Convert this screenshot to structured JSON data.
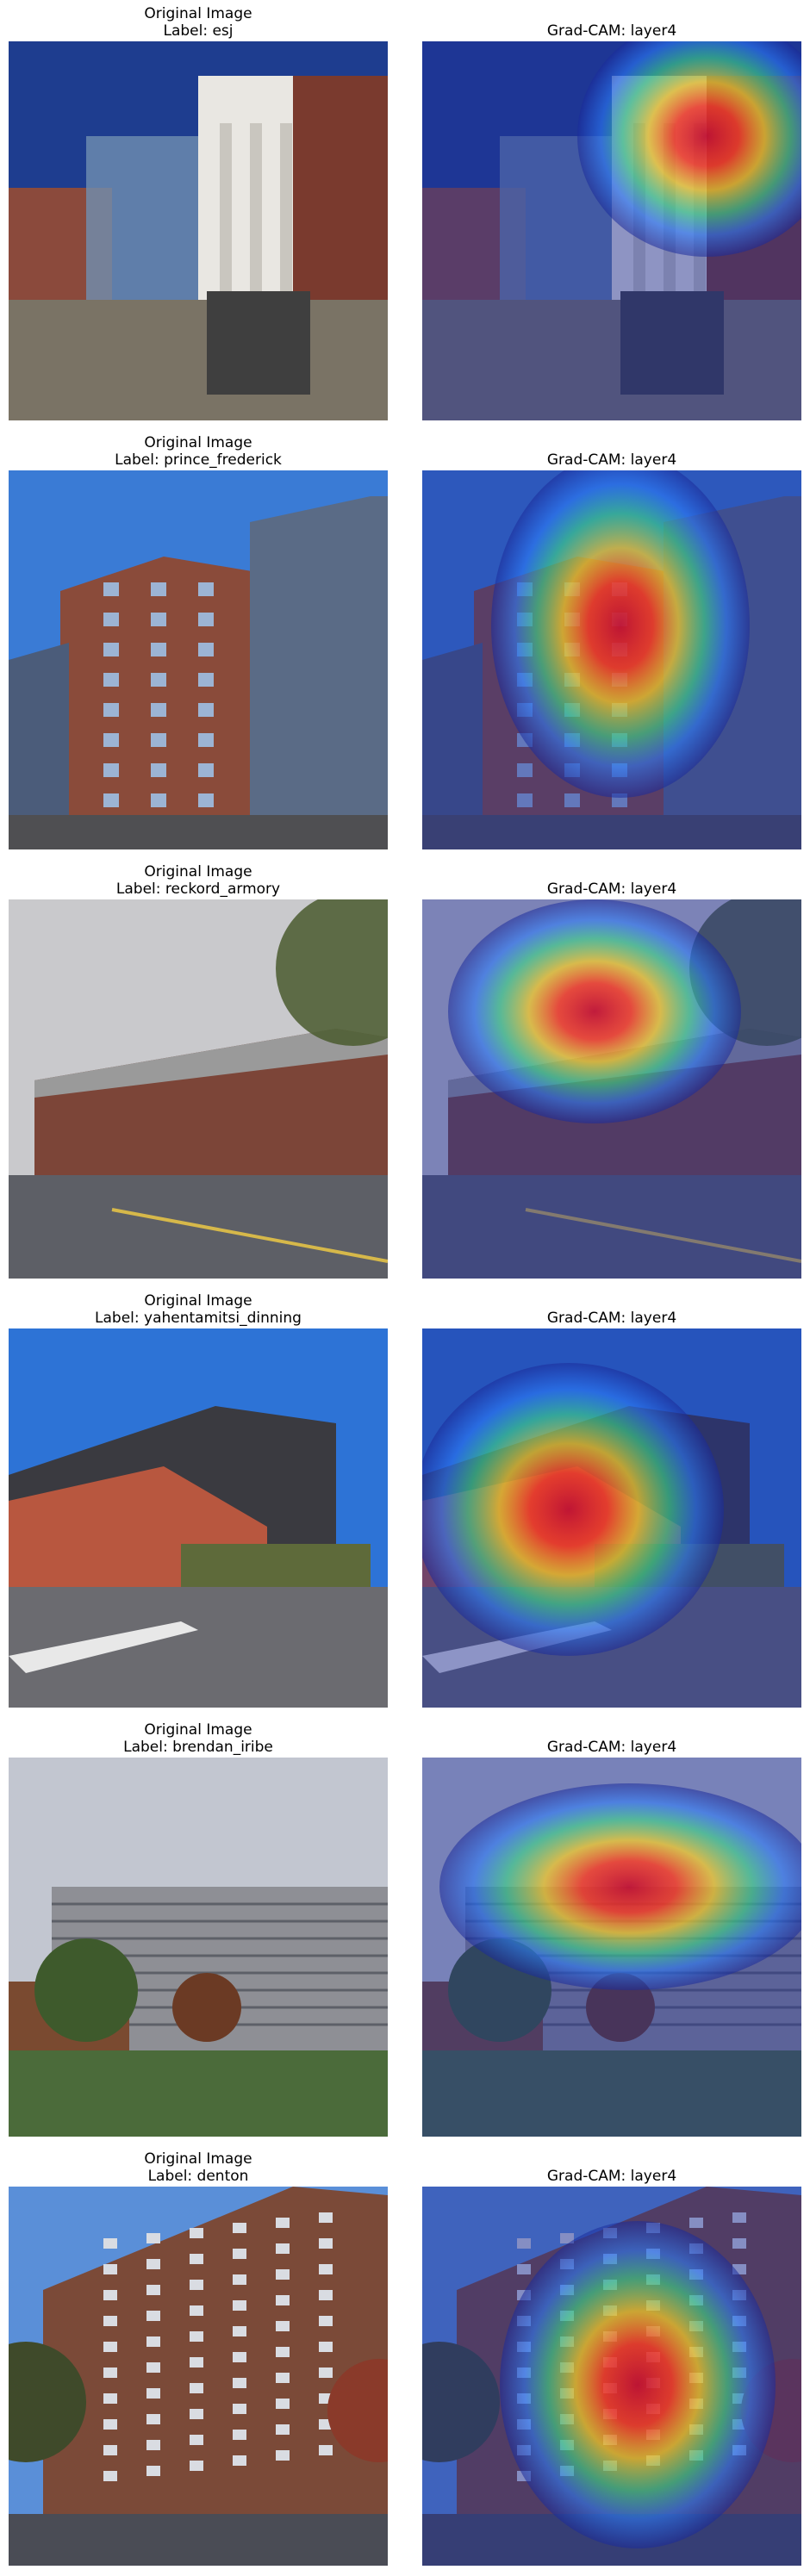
{
  "rows": [
    {
      "left_title": "Original Image",
      "left_label": "Label: esj",
      "right_title": "Grad-CAM: layer4",
      "scene": "campus",
      "palette": {
        "sky": "#1e3d8f",
        "wall": "#8b4a3c",
        "ground": "#7a7365",
        "accent": "#e9e7e2"
      }
    },
    {
      "left_title": "Original Image",
      "left_label": "Label: prince_frederick",
      "right_title": "Grad-CAM: layer4",
      "scene": "tower",
      "palette": {
        "sky": "#3a7bd5",
        "wall": "#8a4b3a",
        "ground": "#4f4f52",
        "accent": "#5a6b86"
      }
    },
    {
      "left_title": "Original Image",
      "left_label": "Label: reckord_armory",
      "right_title": "Grad-CAM: layer4",
      "scene": "armory",
      "palette": {
        "sky": "#c9c9cc",
        "wall": "#7c4538",
        "ground": "#5d5f66",
        "accent": "#4a5a2e"
      }
    },
    {
      "left_title": "Original Image",
      "left_label": "Label: yahentamitsi_dinning",
      "right_title": "Grad-CAM: layer4",
      "scene": "dining",
      "palette": {
        "sky": "#2d73d6",
        "wall": "#b8573f",
        "ground": "#6b6b70",
        "accent": "#3a3a40"
      }
    },
    {
      "left_title": "Original Image",
      "left_label": "Label: brendan_iribe",
      "right_title": "Grad-CAM: layer4",
      "scene": "iribe",
      "palette": {
        "sky": "#c2c6d0",
        "wall": "#8e8f95",
        "ground": "#4b6b3a",
        "accent": "#7a4a30"
      }
    },
    {
      "left_title": "Original Image",
      "left_label": "Label: denton",
      "right_title": "Grad-CAM: layer4",
      "scene": "denton",
      "palette": {
        "sky": "#5a8fd8",
        "wall": "#7b4a38",
        "ground": "#4a4c55",
        "accent": "#8a3a2a"
      }
    }
  ]
}
